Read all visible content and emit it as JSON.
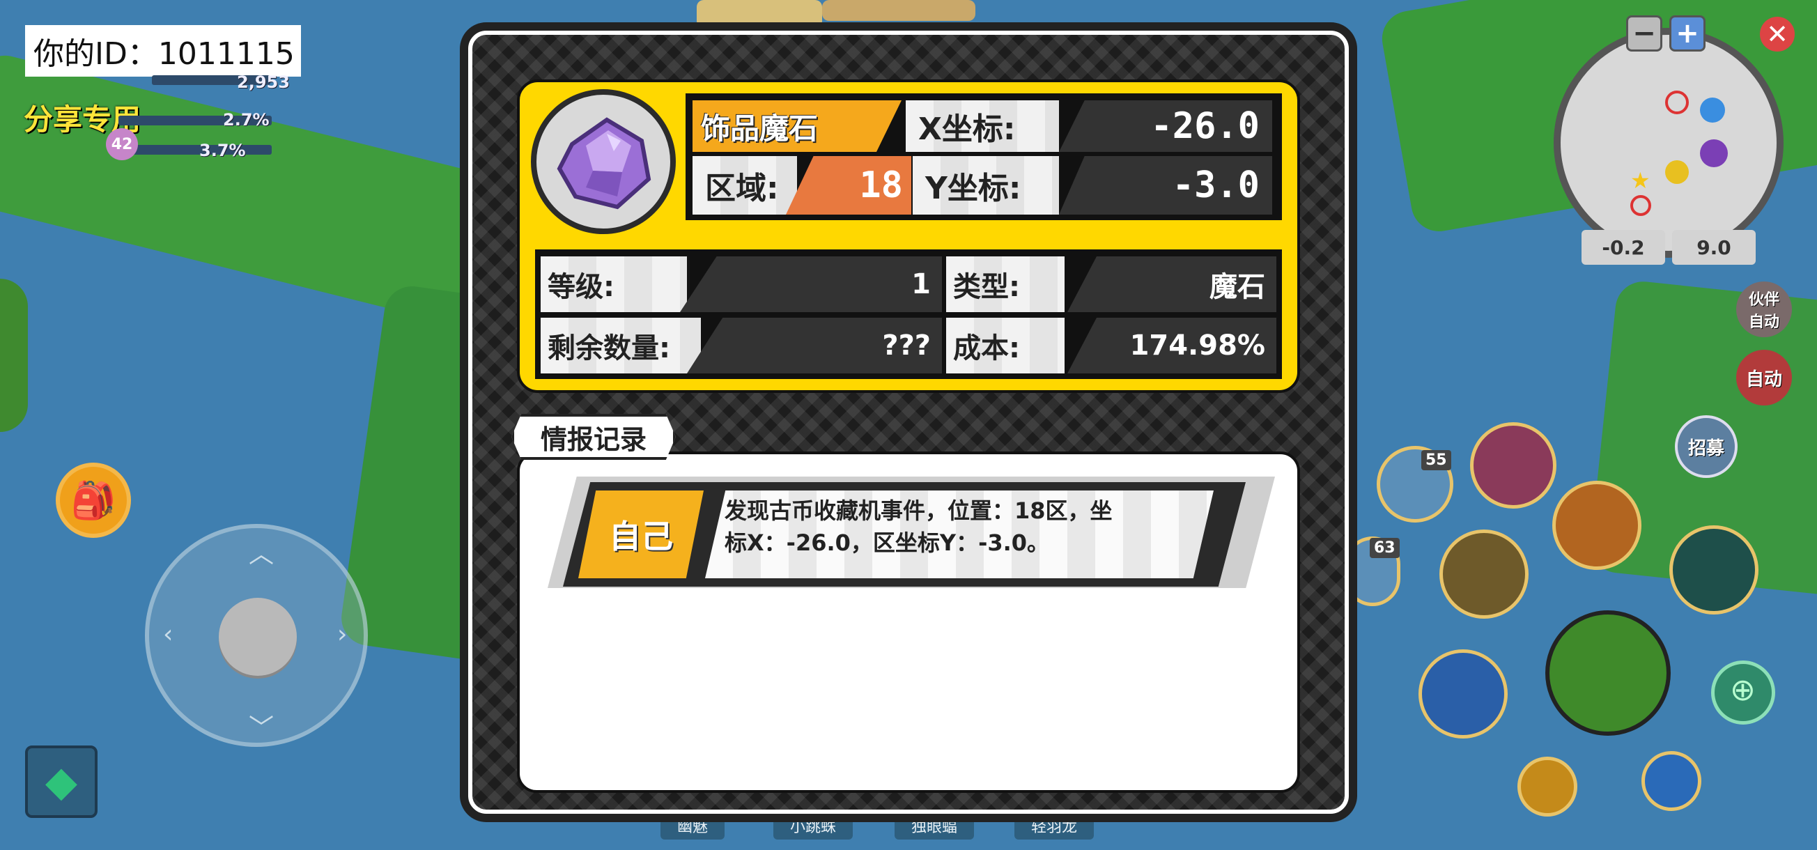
{
  "player": {
    "id_text": "你的ID：1011115",
    "share_label": "分享专用",
    "stat_pct_1": "2.7%",
    "stat_pct_2": "3.7%",
    "stat_level": "42",
    "stat_value": "2,953"
  },
  "minimap": {
    "zoom_out": "−",
    "zoom_in": "+",
    "coord_x": "-0.2",
    "coord_y": "9.0"
  },
  "right_controls": {
    "partner_auto": "伙伴\n自动",
    "auto": "自动",
    "recruit": "招募",
    "potion_red_count": "55",
    "potion_blue_count": "63"
  },
  "bottom_tabs": [
    "幽魅",
    "小跳蛛",
    "独眼蝠",
    "轻羽龙"
  ],
  "item": {
    "name": "饰品魔石",
    "region_label": "区域:",
    "region_value": "18",
    "x_label": "X坐标:",
    "x_value": "-26.0",
    "y_label": "Y坐标:",
    "y_value": "-3.0",
    "level_label": "等级:",
    "level_value": "1",
    "type_label": "类型:",
    "type_value": "魔石",
    "remaining_label": "剩余数量:",
    "remaining_value": "???",
    "cost_label": "成本:",
    "cost_value": "174.98%"
  },
  "records": {
    "tab_label": "情报记录",
    "entries": [
      {
        "author": "自己",
        "line1": "发现古币收藏机事件，位置：18区，坐",
        "line2": "标X：-26.0，区坐标Y：-3.0。"
      }
    ]
  },
  "colors": {
    "card_yellow": "#ffd800",
    "name_orange": "#f5a81c",
    "region_orange": "#e8793f",
    "gem_purple": "#9b6fd6"
  }
}
